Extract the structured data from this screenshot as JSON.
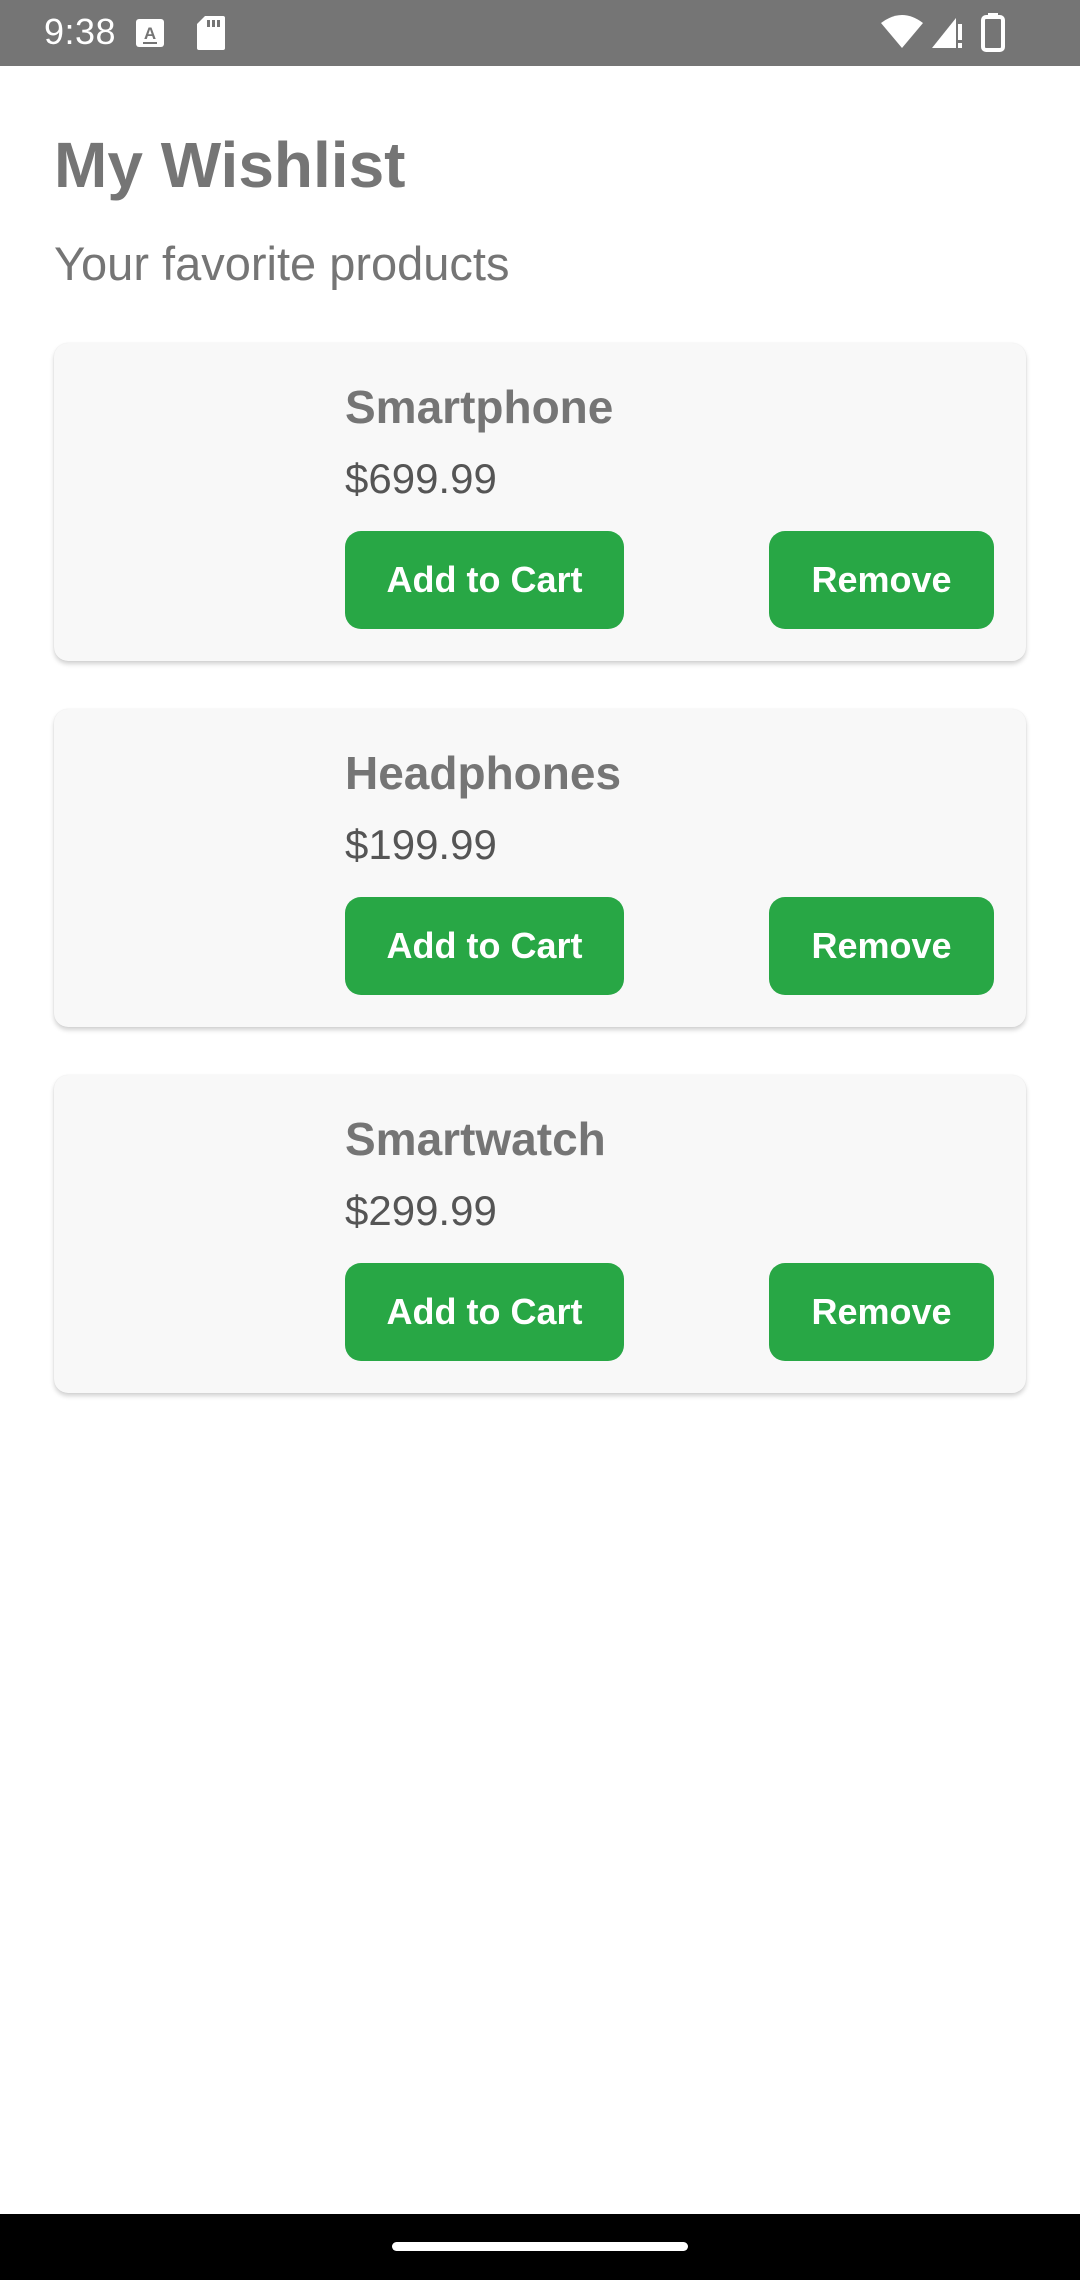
{
  "status_bar": {
    "time": "9:38",
    "icons": [
      "text-a-icon",
      "sd-card-icon",
      "wifi-icon",
      "signal-icon",
      "battery-icon"
    ]
  },
  "header": {
    "title": "My Wishlist",
    "subtitle": "Your favorite products"
  },
  "wishlist": [
    {
      "name": "Smartphone",
      "price": "$699.99",
      "add_label": "Add to Cart",
      "remove_label": "Remove"
    },
    {
      "name": "Headphones",
      "price": "$199.99",
      "add_label": "Add to Cart",
      "remove_label": "Remove"
    },
    {
      "name": "Smartwatch",
      "price": "$299.99",
      "add_label": "Add to Cart",
      "remove_label": "Remove"
    }
  ],
  "colors": {
    "accent": "#28a745",
    "text_muted": "#757575",
    "card_bg": "#f8f8f8",
    "status_bar_bg": "#757575"
  }
}
